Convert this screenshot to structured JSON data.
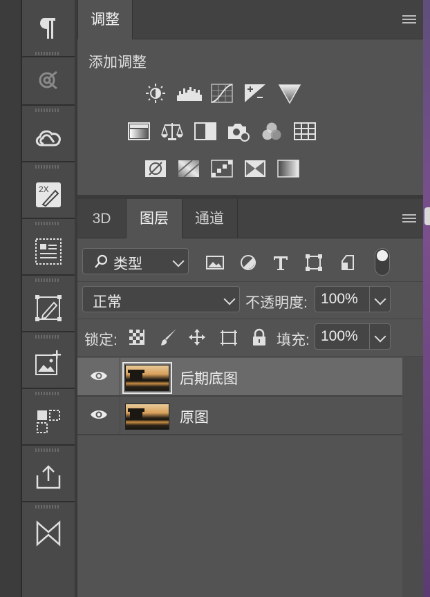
{
  "toolbar": {
    "items": [
      {
        "icon": "paragraph-icon"
      },
      {
        "icon": "behance-icon"
      },
      {
        "icon": "creative-cloud-icon"
      },
      {
        "icon": "2x-edit-icon",
        "badge": "2X"
      },
      {
        "icon": "layout-list-icon"
      },
      {
        "icon": "edit-shape-icon"
      },
      {
        "icon": "add-image-icon"
      },
      {
        "icon": "select-blocks-icon"
      },
      {
        "icon": "export-icon"
      },
      {
        "icon": "bowtie-icon"
      }
    ]
  },
  "adjustments": {
    "tab_label": "调整",
    "title": "添加调整",
    "icons_row1": [
      "brightness-icon",
      "levels-icon",
      "curves-icon",
      "exposure-icon",
      "gradient-map-triangle-icon"
    ],
    "icons_row2": [
      "vibrance-icon",
      "color-balance-icon",
      "black-white-icon",
      "photo-filter-icon",
      "channel-mixer-icon",
      "color-lookup-icon"
    ],
    "icons_row3": [
      "invert-icon",
      "posterize-icon",
      "threshold-icon",
      "selective-color-icon",
      "gradient-map-icon"
    ]
  },
  "layers_panel": {
    "tabs": [
      "3D",
      "图层",
      "通道"
    ],
    "active_tab": "图层",
    "filter": {
      "label": "类型"
    },
    "blend_mode": "正常",
    "opacity_label": "不透明度:",
    "opacity_value": "100%",
    "lock_label": "锁定:",
    "fill_label": "填充:",
    "fill_value": "100%",
    "layers": [
      {
        "name": "后期底图",
        "selected": true,
        "visible": true
      },
      {
        "name": "原图",
        "selected": false,
        "visible": true
      }
    ]
  },
  "colors": {
    "panel_bg": "#535353",
    "toolbar_bg": "#494949",
    "selected_row": "#6a6a6a"
  }
}
